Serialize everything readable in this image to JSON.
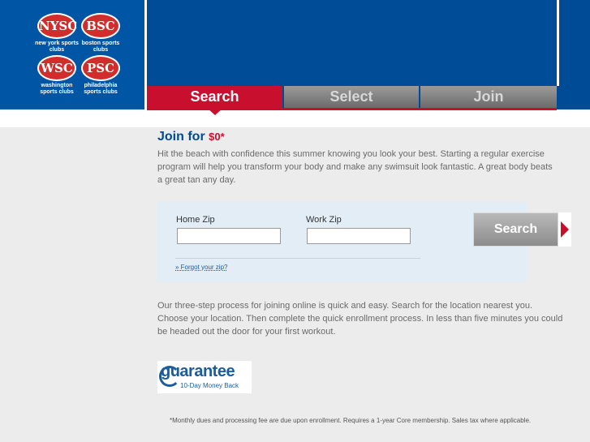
{
  "brand": {
    "logos": [
      {
        "abbr": "NYSC",
        "caption": "new york sports clubs"
      },
      {
        "abbr": "BSC",
        "caption": "boston sports clubs"
      },
      {
        "abbr": "WSC",
        "caption": "washington sports clubs"
      },
      {
        "abbr": "PSC",
        "caption": "philadelphia sports clubs"
      }
    ]
  },
  "tabs": [
    {
      "label": "Search",
      "active": true
    },
    {
      "label": "Select",
      "active": false
    },
    {
      "label": "Join",
      "active": false
    }
  ],
  "main": {
    "title": "Join for ",
    "price": "$0*",
    "intro": "Hit the beach with confidence this summer knowing you look your best. Starting a regular exercise program will help you transform your body and make any swimsuit look fantastic. A great body beats a great tan any day.",
    "process": "Our three-step process for joining online is quick and easy. Search for the location nearest you. Choose your location. Then complete the quick enrollment process. In less than five minutes you could be headed out the door for your first workout."
  },
  "search": {
    "home_zip_label": "Home Zip",
    "home_zip_value": "",
    "work_zip_label": "Work Zip",
    "work_zip_value": "",
    "forgot_link": "» Forgot your zip?",
    "button_label": "Search"
  },
  "guarantee": {
    "main": "guarantee",
    "sub": "10-Day Money Back"
  },
  "footer": {
    "disclaimer": "*Monthly dues and processing fee are due upon enrollment. Requires a 1-year Core membership. Sales tax where applicable."
  },
  "colors": {
    "brand_blue": "#004b96",
    "accent_red": "#c8102e"
  }
}
